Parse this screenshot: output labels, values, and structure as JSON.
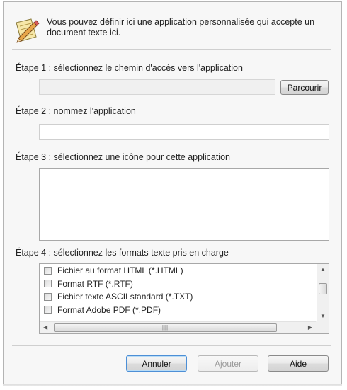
{
  "intro_text": "Vous pouvez définir ici une application personnalisée qui accepte un document texte ici.",
  "step1": {
    "label": "Étape 1 : sélectionnez le chemin d'accès vers l'application",
    "path_value": "",
    "browse_label": "Parcourir"
  },
  "step2": {
    "label": "Étape 2 : nommez l'application",
    "name_value": ""
  },
  "step3": {
    "label": "Étape 3 : sélectionnez une icône pour cette application"
  },
  "step4": {
    "label": "Étape 4 : sélectionnez les formats texte pris en charge",
    "formats": [
      {
        "label": "Fichier au format HTML (*.HTML)",
        "checked": false
      },
      {
        "label": "Format RTF (*.RTF)",
        "checked": false
      },
      {
        "label": "Fichier texte ASCII standard (*.TXT)",
        "checked": false
      },
      {
        "label": "Format Adobe PDF (*.PDF)",
        "checked": false
      }
    ]
  },
  "buttons": {
    "cancel": "Annuler",
    "add": "Ajouter",
    "help": "Aide"
  },
  "icons": {
    "header": "notepad-pencil-icon"
  },
  "colors": {
    "dialog_bg": "#f7f7f7",
    "focus_border": "#4d8fd6"
  }
}
